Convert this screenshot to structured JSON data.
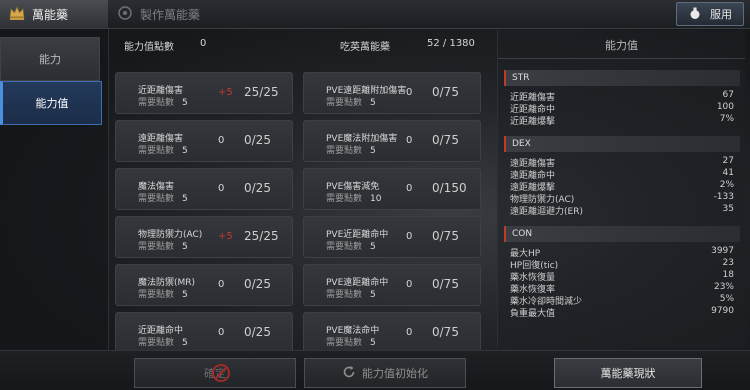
{
  "header": {
    "tab_active": "萬能藥",
    "tab_inactive": "製作萬能藥",
    "use_button": "服用"
  },
  "sidenav": {
    "items": [
      "能力",
      "能力值"
    ]
  },
  "summary": {
    "points_label": "能力值點數",
    "points_value": "0",
    "eaten_label": "吃英萬能藥",
    "eaten_value": "52 / 1380"
  },
  "cards": [
    {
      "name": "近距離傷害",
      "need_label": "需要點數",
      "need": "5",
      "pts": "+5",
      "pts_red": true,
      "level": "25/25"
    },
    {
      "name": "PVE遠距離附加傷害",
      "need_label": "需要點數",
      "need": "5",
      "pts": "0",
      "pts_red": false,
      "level": "0/75"
    },
    {
      "name": "遠距離傷害",
      "need_label": "需要點數",
      "need": "5",
      "pts": "0",
      "pts_red": false,
      "level": "0/25"
    },
    {
      "name": "PVE魔法附加傷害",
      "need_label": "需要點數",
      "need": "5",
      "pts": "0",
      "pts_red": false,
      "level": "0/75"
    },
    {
      "name": "魔法傷害",
      "need_label": "需要點數",
      "need": "5",
      "pts": "0",
      "pts_red": false,
      "level": "0/25"
    },
    {
      "name": "PVE傷害減免",
      "need_label": "需要點數",
      "need": "10",
      "pts": "0",
      "pts_red": false,
      "level": "0/150"
    },
    {
      "name": "物理防禦力(AC)",
      "need_label": "需要點數",
      "need": "5",
      "pts": "+5",
      "pts_red": true,
      "level": "25/25"
    },
    {
      "name": "PVE近距離命中",
      "need_label": "需要點數",
      "need": "5",
      "pts": "0",
      "pts_red": false,
      "level": "0/75"
    },
    {
      "name": "魔法防禦(MR)",
      "need_label": "需要點數",
      "need": "5",
      "pts": "0",
      "pts_red": false,
      "level": "0/25"
    },
    {
      "name": "PVE遠距離命中",
      "need_label": "需要點數",
      "need": "5",
      "pts": "0",
      "pts_red": false,
      "level": "0/75"
    },
    {
      "name": "近距離命中",
      "need_label": "需要點數",
      "need": "5",
      "pts": "0",
      "pts_red": false,
      "level": "0/25"
    },
    {
      "name": "PVE魔法命中",
      "need_label": "需要點數",
      "need": "5",
      "pts": "0",
      "pts_red": false,
      "level": "0/75"
    }
  ],
  "stats_panel": {
    "title": "能力值",
    "sections": [
      {
        "name": "STR",
        "rows": [
          {
            "name": "近距離傷害",
            "value": "67"
          },
          {
            "name": "近距離命中",
            "value": "100"
          },
          {
            "name": "近距離爆擊",
            "value": "7%"
          }
        ]
      },
      {
        "name": "DEX",
        "rows": [
          {
            "name": "遠距離傷害",
            "value": "27"
          },
          {
            "name": "遠距離命中",
            "value": "41"
          },
          {
            "name": "遠距離爆擊",
            "value": "2%"
          },
          {
            "name": "物理防禦力(AC)",
            "value": "-133"
          },
          {
            "name": "遠距離迴避力(ER)",
            "value": "35"
          }
        ]
      },
      {
        "name": "CON",
        "rows": [
          {
            "name": "最大HP",
            "value": "3997"
          },
          {
            "name": "HP回復(tic)",
            "value": "23"
          },
          {
            "name": "藥水恢復量",
            "value": "18"
          },
          {
            "name": "藥水恢復率",
            "value": "23%"
          },
          {
            "name": "藥水冷卻時間減少",
            "value": "5%"
          },
          {
            "name": "負重最大值",
            "value": "9790"
          }
        ]
      }
    ]
  },
  "bottom": {
    "btn1": "確定",
    "btn2": "能力值初始化",
    "btn3": "萬能藥現狀"
  },
  "colors": {
    "accent_red": "#c03a35",
    "active_blue": "#3d6fb0"
  }
}
